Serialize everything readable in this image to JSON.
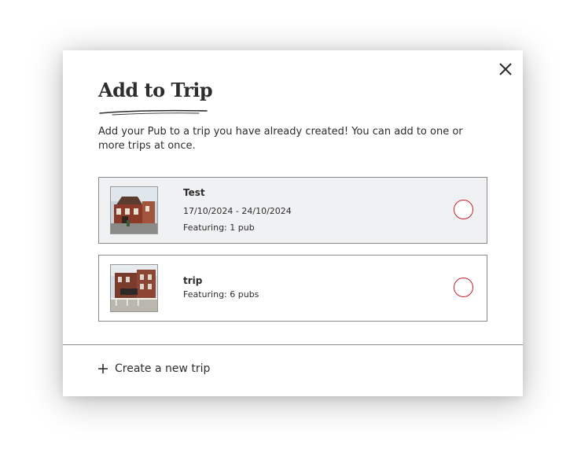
{
  "modal": {
    "title": "Add to Trip",
    "intro": "Add your Pub to a trip you have already created! You can add to one or more trips at once.",
    "close_icon": "close-icon"
  },
  "trips": [
    {
      "name": "Test",
      "dates": "17/10/2024 - 24/10/2024",
      "featuring": "Featuring: 1 pub",
      "selected": false
    },
    {
      "name": "trip",
      "featuring": "Featuring: 6 pubs",
      "selected": false
    }
  ],
  "footer": {
    "create_label": "Create a new trip",
    "create_icon": "plus-icon"
  },
  "colors": {
    "radio_border": "#c8202a",
    "row_highlight": "#f0f1f3",
    "text": "#2d2d2d"
  }
}
